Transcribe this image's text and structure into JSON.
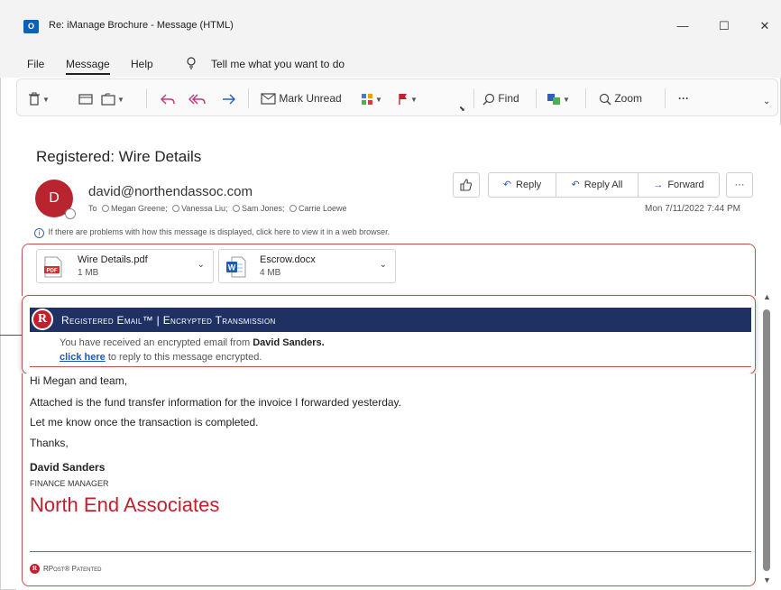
{
  "window": {
    "title": "Re: iManage Brochure - Message (HTML)",
    "app_icon_text": "O",
    "minimize": "—",
    "maximize": "☐",
    "close": "✕"
  },
  "ribbon": {
    "tabs": [
      "File",
      "Message",
      "Help"
    ],
    "active_tab": "Message",
    "tell_me": "Tell me what you want to do"
  },
  "toolbar": {
    "mark_unread": "Mark Unread",
    "find": "Find",
    "zoom": "Zoom",
    "more": "···"
  },
  "message": {
    "subject": "Registered: Wire Details",
    "avatar_initial": "D",
    "sender": "david@northendassoc.com",
    "to_label": "To",
    "recipients": [
      "Megan Greene;",
      "Vanessa Liu;",
      "Sam Jones;",
      "Carrie Loewe"
    ],
    "date": "Mon 7/11/2022 7:44 PM",
    "info_bar": "If there are problems with how this message is displayed, click here to view it in a web browser.",
    "actions": {
      "reply": "Reply",
      "reply_all": "Reply All",
      "forward": "Forward",
      "more": "···"
    }
  },
  "attachments": [
    {
      "name": "Wire Details.pdf",
      "size": "1 MB",
      "type": "pdf",
      "badge": "PDF"
    },
    {
      "name": "Escrow.docx",
      "size": "4 MB",
      "type": "docx",
      "badge": "W"
    }
  ],
  "banner": {
    "logo_letter": "R",
    "title": "Registered Email™ | Encrypted Transmission",
    "line1_prefix": "You have received an encrypted email from ",
    "line1_sender": "David Sanders.",
    "link_text": "click here",
    "line2_suffix": " to reply to this message encrypted."
  },
  "body": {
    "greeting": "Hi Megan and team,",
    "line1": "Attached is the fund transfer information for the invoice I forwarded yesterday.",
    "line2": "Let me know once the transaction is completed.",
    "signoff": "Thanks,",
    "sig_name": "David Sanders",
    "sig_role": "FINANCE MANAGER",
    "sig_company": "North End Associates",
    "footer": "RPost® Patented"
  },
  "colors": {
    "brand_red": "#c3202e",
    "banner_navy": "#1f3163",
    "highlight_border": "#c0504d",
    "link_blue": "#1a56c4"
  }
}
